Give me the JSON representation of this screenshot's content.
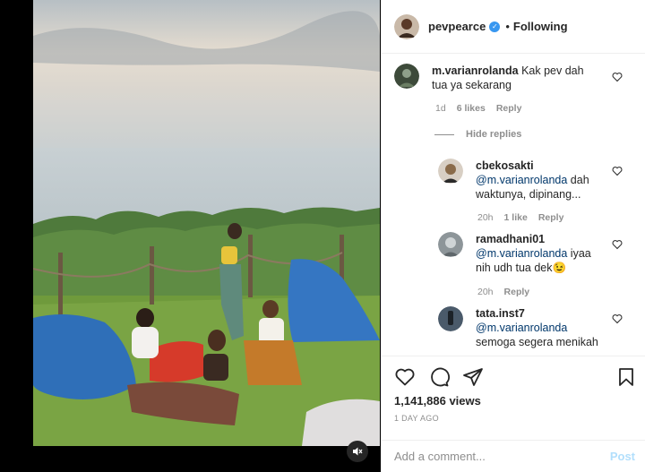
{
  "header": {
    "username": "pevpearce",
    "separator": "•",
    "follow_label": "Following"
  },
  "comments": [
    {
      "username": "m.varianrolanda",
      "text": "Kak pev dah tua ya sekarang",
      "time": "1d",
      "likes": "6 likes",
      "reply": "Reply",
      "avatar_color": "#3d4a3a"
    }
  ],
  "hide_replies": "Hide replies",
  "replies": [
    {
      "username": "cbekosakti",
      "mention": "@m.varianrolanda",
      "text": " dah waktunya, dipinang...",
      "time": "20h",
      "likes": "1 like",
      "reply": "Reply",
      "avatar_color": "#8a6b4a"
    },
    {
      "username": "ramadhani01",
      "mention": "@m.varianrolanda",
      "text": " iyaa nih udh tua dek",
      "emoji": "😉",
      "time": "20h",
      "reply": "Reply",
      "avatar_color": "#8d9599"
    },
    {
      "username": "tata.inst7",
      "mention": "@m.varianrolanda",
      "text": " semoga segera menikah",
      "avatar_color": "#4a5a6a"
    }
  ],
  "actions": {
    "views": "1,141,886 views",
    "date": "1 DAY AGO"
  },
  "add_comment": {
    "placeholder": "Add a comment...",
    "post_label": "Post"
  },
  "icons": [
    "heart-icon",
    "comment-icon",
    "share-icon",
    "bookmark-icon",
    "mute-icon",
    "verified-badge-icon"
  ],
  "colors": {
    "link": "#00376b",
    "verified": "#3897f0",
    "muted_text": "#8e8e8e",
    "post_disabled": "#b2dffc"
  }
}
